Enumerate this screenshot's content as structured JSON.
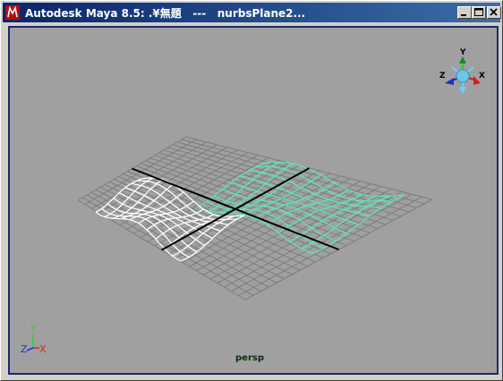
{
  "window": {
    "title": "Autodesk Maya 8.5: .¥無題   ---   nurbsPlane2..."
  },
  "viewport": {
    "camera_label": "persp"
  },
  "view_cube": {
    "y_label": "Y",
    "x_label": "X",
    "z_label": "Z"
  },
  "axis_indicator": {
    "y_label": "Y",
    "z_label": "Z",
    "x_label": "X"
  },
  "colors": {
    "title_bar": "#0a246a",
    "viewport_bg": "#a0a0a0",
    "viewport_border": "#1c2a6b",
    "grid_line": "#7d7d7d",
    "axis_line": "#000000",
    "selected_surface": "#ffffff",
    "other_surface": "#5fe3b4"
  },
  "icons": [
    "maya-app-icon",
    "minimize-icon",
    "maximize-icon",
    "close-icon",
    "view-cube-icon",
    "axis-indicator-icon"
  ]
}
